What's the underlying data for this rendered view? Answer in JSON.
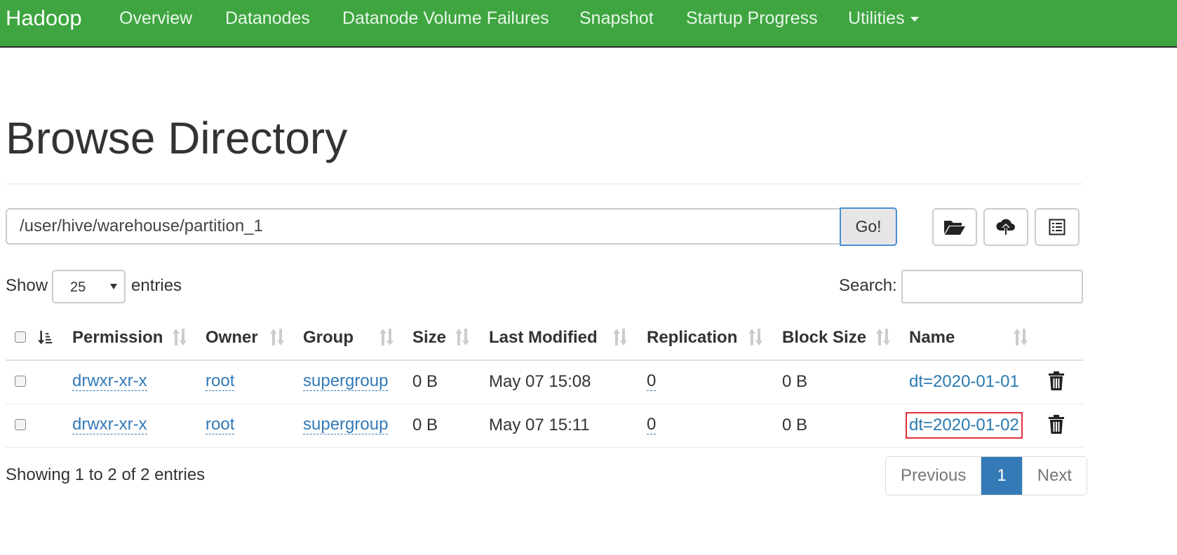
{
  "navbar": {
    "brand": "Hadoop",
    "items": [
      "Overview",
      "Datanodes",
      "Datanode Volume Failures",
      "Snapshot",
      "Startup Progress",
      "Utilities"
    ]
  },
  "page_title": "Browse Directory",
  "path_bar": {
    "value": "/user/hive/warehouse/partition_1",
    "go_label": "Go!"
  },
  "toolbar_icons": [
    "folder-open-icon",
    "cloud-upload-icon",
    "list-icon"
  ],
  "length_menu": {
    "show_label": "Show",
    "selected": "25",
    "entries_label": "entries"
  },
  "search": {
    "label": "Search:",
    "value": ""
  },
  "table": {
    "columns": [
      "Permission",
      "Owner",
      "Group",
      "Size",
      "Last Modified",
      "Replication",
      "Block Size",
      "Name"
    ],
    "rows": [
      {
        "permission": "drwxr-xr-x",
        "owner": "root",
        "group": "supergroup",
        "size": "0 B",
        "last_modified": "May 07 15:08",
        "replication": "0",
        "block_size": "0 B",
        "name": "dt=2020-01-01",
        "highlighted": false
      },
      {
        "permission": "drwxr-xr-x",
        "owner": "root",
        "group": "supergroup",
        "size": "0 B",
        "last_modified": "May 07 15:11",
        "replication": "0",
        "block_size": "0 B",
        "name": "dt=2020-01-02",
        "highlighted": true
      }
    ]
  },
  "info_text": "Showing 1 to 2 of 2 entries",
  "pagination": {
    "previous": "Previous",
    "current": "1",
    "next": "Next"
  },
  "colors": {
    "navbar": "#3ea540",
    "link": "#337ab7",
    "active_page": "#337ab7",
    "highlight_box": "#e0303a"
  }
}
